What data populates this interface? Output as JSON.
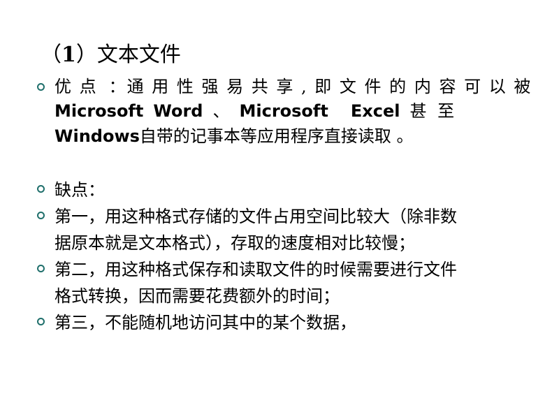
{
  "slide": {
    "background_color": "#ffffff",
    "text_color": "#000000",
    "bullet_color": "#1f6f6b",
    "title": {
      "prefix": "（",
      "number": "1",
      "suffix": "）文本文件"
    },
    "advantage_bullet": {
      "line1_label": "优 点",
      "line1_rest": "：通 用 性 强 易 共 享 , 即 文 件 的 内 容 可 以 被",
      "line2_part1": "Microsoft",
      "line2_part2": "Word",
      "line2_sep": "、",
      "line2_part3": "Microsoft",
      "line2_part4": "Excel",
      "line2_tail": "甚 至",
      "line3_lat": "Windows",
      "line3_han": "自带的记事本等应用程序直接读取 。"
    },
    "disadvantage_bullets": [
      {
        "lines": [
          "缺点："
        ]
      },
      {
        "lines": [
          "第一，用这种格式存储的文件占用空间比较大（除非数",
          "据原本就是文本格式），存取的速度相对比较慢；"
        ]
      },
      {
        "lines": [
          "第二，用这种格式保存和读取文件的时候需要进行文件",
          "格式转换，因而需要花费额外的时间；"
        ]
      },
      {
        "lines": [
          "第三，不能随机地访问其中的某个数据，"
        ]
      }
    ]
  }
}
